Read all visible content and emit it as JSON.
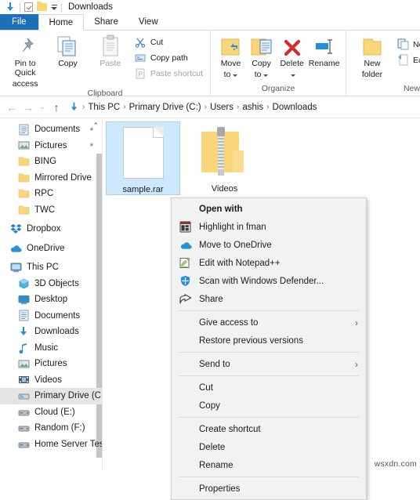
{
  "window": {
    "title": "Downloads",
    "quick_access": [
      {
        "name": "downloads-qat",
        "icon": "download-arrow-icon"
      },
      {
        "name": "properties-qat",
        "icon": "properties-checkmark-icon"
      },
      {
        "name": "new-folder-qat",
        "icon": "folder-icon"
      },
      {
        "name": "customize-qat",
        "icon": "chevron-down-icon"
      }
    ]
  },
  "tabs": [
    {
      "label": "File",
      "active": false,
      "file": true
    },
    {
      "label": "Home",
      "active": true,
      "file": false
    },
    {
      "label": "Share",
      "active": false,
      "file": false
    },
    {
      "label": "View",
      "active": false,
      "file": false
    }
  ],
  "ribbon": {
    "groups": [
      {
        "label": "Clipboard",
        "big": [
          {
            "label": "Pin to Quick\naccess",
            "line1": "Pin to Quick",
            "line2": "access",
            "icon": "pin-icon",
            "dim": false
          },
          {
            "label": "Copy",
            "line1": "Copy",
            "line2": "",
            "icon": "copy-icon",
            "dim": false
          },
          {
            "label": "Paste",
            "line1": "Paste",
            "line2": "",
            "icon": "paste-icon",
            "dim": true
          }
        ],
        "small": [
          {
            "label": "Cut",
            "icon": "scissors-icon",
            "dim": false
          },
          {
            "label": "Copy path",
            "icon": "copy-path-icon",
            "dim": false
          },
          {
            "label": "Paste shortcut",
            "icon": "paste-shortcut-icon",
            "dim": true
          }
        ]
      },
      {
        "label": "Organize",
        "big": [
          {
            "line1": "Move",
            "line2": "to",
            "icon": "move-to-icon",
            "caret": true
          },
          {
            "line1": "Copy",
            "line2": "to",
            "icon": "copy-to-icon",
            "caret": true
          },
          {
            "line1": "Delete",
            "line2": "",
            "icon": "delete-x-icon",
            "caret": true
          },
          {
            "line1": "Rename",
            "line2": "",
            "icon": "rename-icon",
            "caret": false
          }
        ],
        "small": []
      },
      {
        "label": "New",
        "big": [
          {
            "line1": "New",
            "line2": "folder",
            "icon": "new-folder-icon",
            "caret": false
          }
        ],
        "small": [
          {
            "label": "New item",
            "icon": "new-item-icon",
            "caret": true
          },
          {
            "label": "Easy access",
            "icon": "easy-access-icon",
            "caret": true
          }
        ]
      }
    ]
  },
  "address_bar": {
    "back": "←",
    "forward": "→",
    "history": "⌄",
    "up": "↑",
    "path_icon": "download-arrow-icon",
    "crumbs": [
      "This PC",
      "Primary Drive (C:)",
      "Users",
      "ashis",
      "Downloads"
    ],
    "separator": "›"
  },
  "sidebar": {
    "chevron": "⌃",
    "items": [
      {
        "label": "Documents",
        "icon": "documents-icon",
        "pinned": true,
        "selected": false,
        "indent": 1
      },
      {
        "label": "Pictures",
        "icon": "pictures-icon",
        "pinned": true,
        "selected": false,
        "indent": 1
      },
      {
        "label": "BING",
        "icon": "folder-icon",
        "pinned": false,
        "selected": false,
        "indent": 1
      },
      {
        "label": "Mirrored Drive",
        "icon": "folder-icon",
        "pinned": false,
        "selected": false,
        "indent": 1
      },
      {
        "label": "RPC",
        "icon": "folder-icon",
        "pinned": false,
        "selected": false,
        "indent": 1
      },
      {
        "label": "TWC",
        "icon": "folder-icon",
        "pinned": false,
        "selected": false,
        "indent": 1
      },
      {
        "label": "Dropbox",
        "icon": "dropbox-icon",
        "pinned": false,
        "selected": false,
        "indent": 0,
        "gap": true
      },
      {
        "label": "OneDrive",
        "icon": "onedrive-icon",
        "pinned": false,
        "selected": false,
        "indent": 0,
        "gap": true
      },
      {
        "label": "This PC",
        "icon": "this-pc-icon",
        "pinned": false,
        "selected": false,
        "indent": 0,
        "gap": true
      },
      {
        "label": "3D Objects",
        "icon": "3d-objects-icon",
        "pinned": false,
        "selected": false,
        "indent": 1
      },
      {
        "label": "Desktop",
        "icon": "desktop-icon",
        "pinned": false,
        "selected": false,
        "indent": 1
      },
      {
        "label": "Documents",
        "icon": "documents-icon",
        "pinned": false,
        "selected": false,
        "indent": 1
      },
      {
        "label": "Downloads",
        "icon": "download-arrow-icon",
        "pinned": false,
        "selected": false,
        "indent": 1
      },
      {
        "label": "Music",
        "icon": "music-note-icon",
        "pinned": false,
        "selected": false,
        "indent": 1
      },
      {
        "label": "Pictures",
        "icon": "pictures-icon",
        "pinned": false,
        "selected": false,
        "indent": 1
      },
      {
        "label": "Videos",
        "icon": "videos-icon",
        "pinned": false,
        "selected": false,
        "indent": 1
      },
      {
        "label": "Primary Drive (C",
        "icon": "drive-icon",
        "pinned": false,
        "selected": true,
        "indent": 1
      },
      {
        "label": "Cloud (E:)",
        "icon": "drive-icon",
        "pinned": false,
        "selected": false,
        "indent": 1
      },
      {
        "label": "Random (F:)",
        "icon": "drive-icon",
        "pinned": false,
        "selected": false,
        "indent": 1
      },
      {
        "label": "Home Server Tes",
        "icon": "drive-icon",
        "pinned": false,
        "selected": false,
        "indent": 1
      }
    ]
  },
  "files": [
    {
      "name": "sample.rar",
      "type": "document",
      "selected": true
    },
    {
      "name": "Videos",
      "type": "zipped-folder",
      "selected": false
    }
  ],
  "context_menu": {
    "items": [
      {
        "label": "Open with",
        "icon": "",
        "bold": true,
        "arrow": false,
        "type": "item"
      },
      {
        "label": "Highlight in fman",
        "icon": "fman-icon",
        "bold": false,
        "arrow": false,
        "type": "item"
      },
      {
        "label": "Move to OneDrive",
        "icon": "onedrive-icon",
        "bold": false,
        "arrow": false,
        "type": "item"
      },
      {
        "label": "Edit with Notepad++",
        "icon": "notepadpp-icon",
        "bold": false,
        "arrow": false,
        "type": "item"
      },
      {
        "label": "Scan with Windows Defender...",
        "icon": "defender-shield-icon",
        "bold": false,
        "arrow": false,
        "type": "item"
      },
      {
        "label": "Share",
        "icon": "share-icon",
        "bold": false,
        "arrow": false,
        "type": "item"
      },
      {
        "type": "separator"
      },
      {
        "label": "Give access to",
        "icon": "",
        "bold": false,
        "arrow": true,
        "type": "item"
      },
      {
        "label": "Restore previous versions",
        "icon": "",
        "bold": false,
        "arrow": false,
        "type": "item"
      },
      {
        "type": "separator"
      },
      {
        "label": "Send to",
        "icon": "",
        "bold": false,
        "arrow": true,
        "type": "item"
      },
      {
        "type": "separator"
      },
      {
        "label": "Cut",
        "icon": "",
        "bold": false,
        "arrow": false,
        "type": "item"
      },
      {
        "label": "Copy",
        "icon": "",
        "bold": false,
        "arrow": false,
        "type": "item"
      },
      {
        "type": "separator"
      },
      {
        "label": "Create shortcut",
        "icon": "",
        "bold": false,
        "arrow": false,
        "type": "item"
      },
      {
        "label": "Delete",
        "icon": "",
        "bold": false,
        "arrow": false,
        "type": "item"
      },
      {
        "label": "Rename",
        "icon": "",
        "bold": false,
        "arrow": false,
        "type": "item"
      },
      {
        "type": "separator"
      },
      {
        "label": "Properties",
        "icon": "",
        "bold": false,
        "arrow": false,
        "type": "item"
      }
    ],
    "submenu_arrow": "›"
  },
  "watermark": "wsxdn.com",
  "colors": {
    "file_tab": "#1d6fb8",
    "selection": "#cde8ff",
    "sidebar_selection": "#e5e5e5",
    "folder_yellow": "#fbd579",
    "menu_bg": "#f2f2f2"
  }
}
